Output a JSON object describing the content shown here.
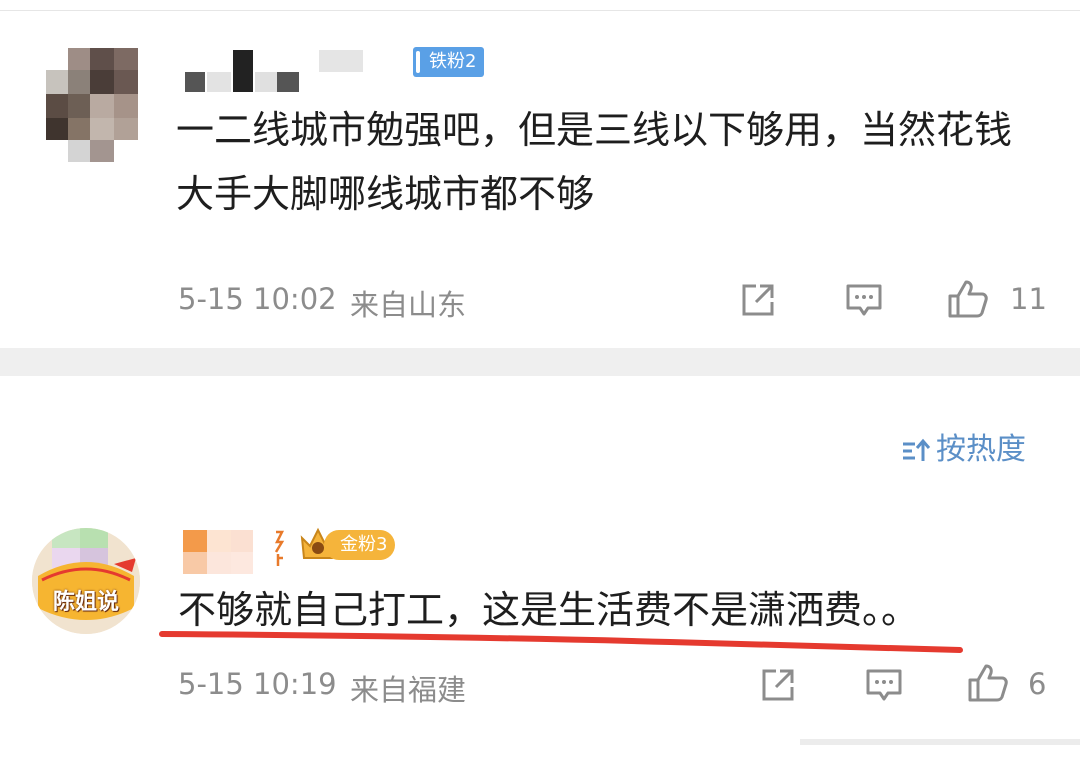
{
  "comment1": {
    "badge": "铁粉2",
    "text": "一二线城市勉强吧，但是三线以下够用，当然花钱大手大脚哪线城市都不够",
    "time": "5-15 10:02",
    "location": "来自山东",
    "likes": "11"
  },
  "sort_label": "按热度",
  "comment2": {
    "avatar_text": "陈姐说",
    "badge": "金粉3",
    "text": "不够就自己打工，这是生活费不是潇洒费。。",
    "time": "5-15 10:19",
    "location": "来自福建",
    "likes": "6"
  },
  "colors": {
    "accent_blue": "#5b8fc7",
    "iron_badge": "#5aa0e6",
    "gold_badge": "#f5b43b",
    "underline": "#e53a2f",
    "meta_gray": "#8c8c8c"
  },
  "icons": [
    "share-icon",
    "comment-icon",
    "like-icon",
    "sort-icon"
  ]
}
